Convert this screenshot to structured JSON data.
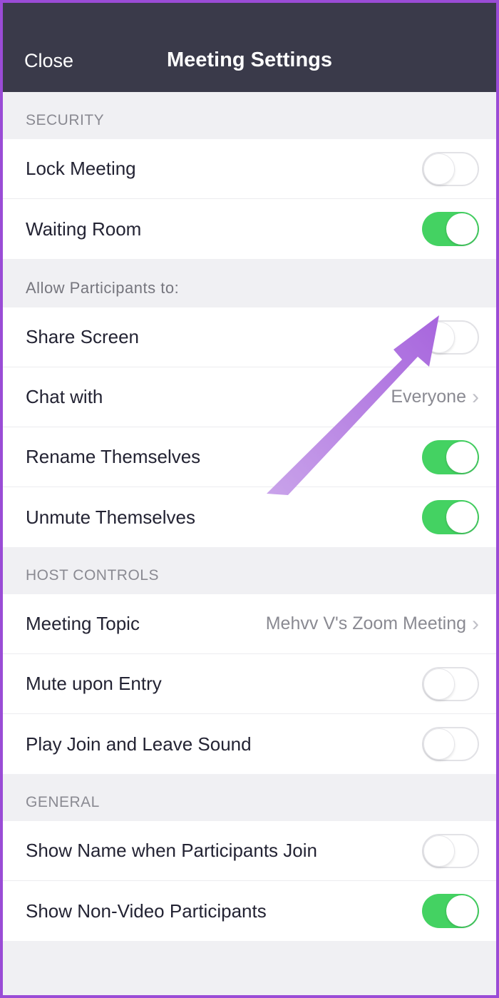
{
  "header": {
    "close_label": "Close",
    "title": "Meeting Settings"
  },
  "sections": {
    "security": {
      "header": "SECURITY",
      "lock_meeting": {
        "label": "Lock Meeting",
        "on": false
      },
      "waiting_room": {
        "label": "Waiting Room",
        "on": true
      }
    },
    "allow": {
      "header": "Allow Participants to:",
      "share_screen": {
        "label": "Share Screen",
        "on": false
      },
      "chat_with": {
        "label": "Chat with",
        "value": "Everyone"
      },
      "rename": {
        "label": "Rename Themselves",
        "on": true
      },
      "unmute": {
        "label": "Unmute Themselves",
        "on": true
      }
    },
    "host": {
      "header": "HOST CONTROLS",
      "meeting_topic": {
        "label": "Meeting Topic",
        "value": "Mehvv V's Zoom Meeting"
      },
      "mute_entry": {
        "label": "Mute upon Entry",
        "on": false
      },
      "play_sound": {
        "label": "Play Join and Leave Sound",
        "on": false
      }
    },
    "general": {
      "header": "GENERAL",
      "show_name": {
        "label": "Show Name when Participants Join",
        "on": false
      },
      "show_nonvideo": {
        "label": "Show Non-Video Participants",
        "on": true
      }
    }
  },
  "annotation": {
    "arrow_color": "#b97de8"
  }
}
